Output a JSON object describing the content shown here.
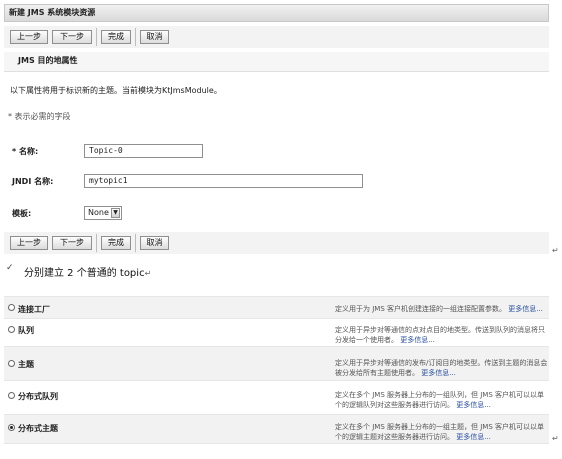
{
  "panel": {
    "title": "新建 JMS 系统模块资源",
    "buttons": {
      "back": "上一步",
      "next": "下一步",
      "finish": "完成",
      "cancel": "取消"
    },
    "section_title": "JMS 目的地属性",
    "description": "以下属性将用于标识新的主题。当前模块为KtJmsModule。",
    "required_note": "* 表示必需的字段"
  },
  "form": {
    "name_label": "* 名称:",
    "name_value": "Topic-0",
    "jndi_label": "JNDI 名称:",
    "jndi_value": "mytopic1",
    "template_label": "模板:",
    "template_value": "None"
  },
  "caption": {
    "bullet": "✓",
    "text": "分别建立 2 个普通的 topic",
    "mark": "↵"
  },
  "options": [
    {
      "label": "连接工厂",
      "desc": "定义用于为 JMS 客户机创建连接的一组连接配置参数。",
      "more": "更多信息...",
      "selected": false
    },
    {
      "label": "队列",
      "desc": "定义用于异步对等通信的点对点目的地类型。传送到队列的消息将只分发给一个使用者。",
      "more": "更多信息...",
      "selected": false
    },
    {
      "label": "主题",
      "desc": "定义用于异步对等通信的发布/订阅目的地类型。传送到主题的消息会被分发给所有主题使用者。",
      "more": "更多信息...",
      "selected": false
    },
    {
      "label": "分布式队列",
      "desc": "定义在多个 JMS 服务器上分布的一组队列，但 JMS 客户机可以以单个的逻辑队列对这些服务器进行访问。",
      "more": "更多信息...",
      "selected": false
    },
    {
      "label": "分布式主题",
      "desc": "定义在多个 JMS 服务器上分布的一组主题，但 JMS 客户机可以以单个的逻辑主题对这些服务器进行访问。",
      "more": "更多信息...",
      "selected": true
    }
  ],
  "return_mark": "↵"
}
